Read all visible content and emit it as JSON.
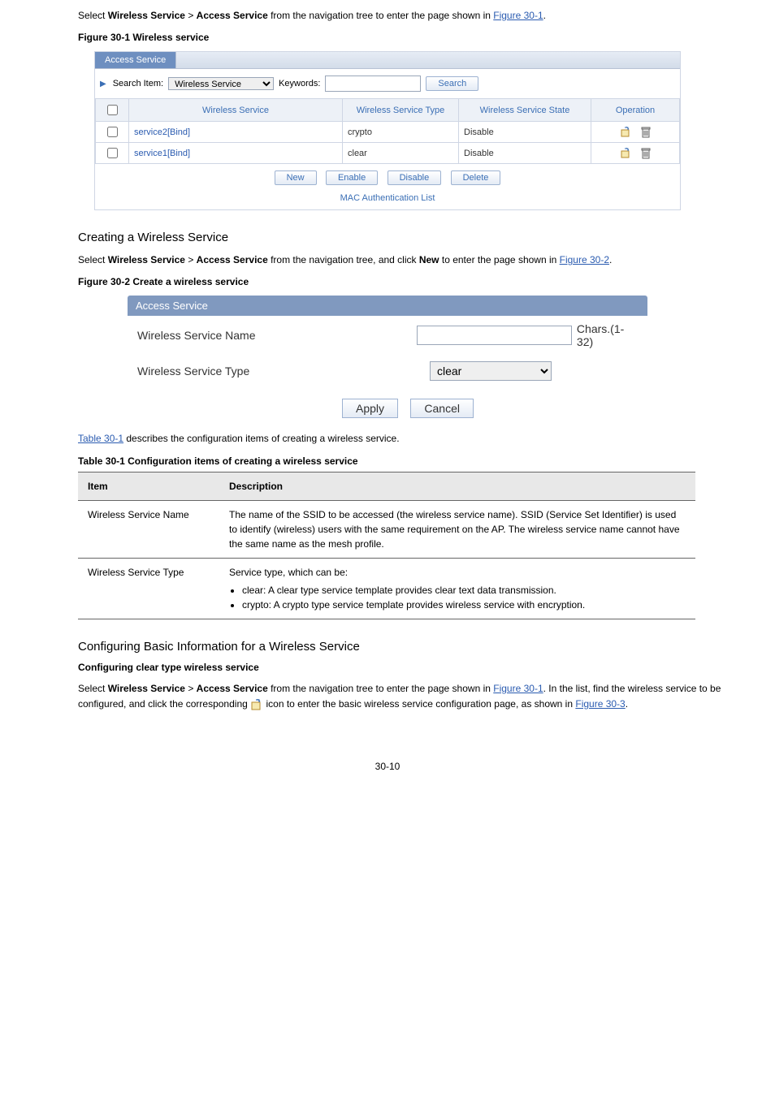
{
  "intro": {
    "p1_a": "Select ",
    "p1_b": "Wireless Service",
    "p1_c": " > ",
    "p1_d": "Access Service",
    "p1_e": " from the navigation tree to enter the page shown in ",
    "p1_link": "Figure 30-1",
    "p1_f": ". "
  },
  "fig1_label": "Figure 30-1 Wireless service",
  "fig1": {
    "tab": "Access Service",
    "search_item_label": "Search Item:",
    "search_item_value": "Wireless Service",
    "keywords_label": "Keywords:",
    "keywords_value": "",
    "search_btn": "Search",
    "th_chk": "",
    "th_service": "Wireless Service",
    "th_type": "Wireless Service Type",
    "th_state": "Wireless Service State",
    "th_op": "Operation",
    "rows": [
      {
        "name": "service2[Bind]",
        "type": "crypto",
        "state": "Disable"
      },
      {
        "name": "service1[Bind]",
        "type": "clear",
        "state": "Disable"
      }
    ],
    "btn_new": "New",
    "btn_enable": "Enable",
    "btn_disable": "Disable",
    "btn_delete": "Delete",
    "mac_link": "MAC Authentication List"
  },
  "section_create": {
    "title": "Creating a Wireless Service",
    "p_a": "Select ",
    "p_b": "Wireless Service",
    "p_c": " > ",
    "p_d": "Access Service",
    "p_e": " from the navigation tree, and click ",
    "p_f": "New",
    "p_g": " to enter the page shown in ",
    "p_link": "Figure 30-2",
    "p_h": "."
  },
  "fig2_label": "Figure 30-2 Create a wireless service",
  "fig2": {
    "tab": "Access Service",
    "name_label": "Wireless Service Name",
    "name_value": "",
    "chars": "Chars.(1-32)",
    "type_label": "Wireless Service Type",
    "type_value": "clear",
    "apply": "Apply",
    "cancel": "Cancel"
  },
  "table_caption_a": "Table 30-1",
  "table_caption_b": " describes the configuration items of creating a wireless service. ",
  "table_title": "Table 30-1 Configuration items of creating a wireless service",
  "desc_table": {
    "th_item": "Item",
    "th_desc": "Description",
    "r1_item": "Wireless Service Name",
    "r1_desc": "The name of the SSID to be accessed (the wireless service name). \nSSID (Service Set Identifier) is used to identify (wireless) users with the same requirement on the AP. \nThe wireless service name cannot have the same name as the mesh profile. ",
    "r2_item": "Wireless Service Type",
    "r2_desc_a": "Service type, which can be:",
    "r2_b1": "clear: A clear type service template provides clear text data transmission.",
    "r2_b2": "crypto: A crypto type service template provides wireless service with encryption."
  },
  "section_basic": {
    "title": "Configuring Basic Information for a Wireless Service",
    "sub": "Configuring clear type wireless service",
    "p_a": "Select ",
    "p_b": "Wireless Service",
    "p_c": " > ",
    "p_d": "Access Service",
    "p_e": " from the navigation tree to enter the page shown in ",
    "p_link1": "Figure 30-1",
    "p_f": ". In the list, find the wireless service to be configured, and click the corresponding ",
    "p_g": " icon to enter the basic wireless service configuration page, as shown in ",
    "p_link2": "Figure 30-3",
    "p_h": ". "
  },
  "page_no": "30-10"
}
